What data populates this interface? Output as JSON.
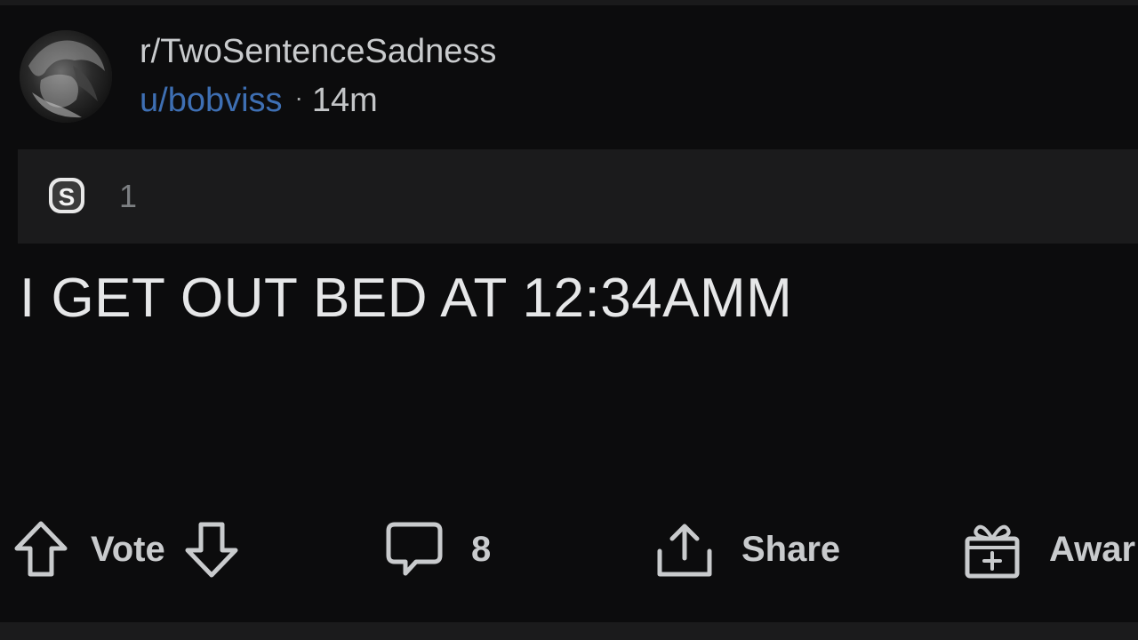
{
  "post": {
    "subreddit": "r/TwoSentenceSadness",
    "username": "u/bobviss",
    "separator": "·",
    "age": "14m",
    "award_count": "1",
    "title": "I GET OUT BED AT 12:34AMM"
  },
  "actions": {
    "vote_label": "Vote",
    "comment_count": "8",
    "share_label": "Share",
    "award_label": "Awar"
  },
  "icons": {
    "avatar": "avatar-image",
    "award": "silver-award-icon",
    "upvote": "upvote-arrow-icon",
    "downvote": "downvote-arrow-icon",
    "comment": "comment-bubble-icon",
    "share": "share-upload-icon",
    "gift": "gift-icon"
  },
  "colors": {
    "background": "#0c0c0d",
    "username": "#3e6fb3",
    "awards_bar": "#1b1b1c",
    "text": "#e6e7e8"
  }
}
